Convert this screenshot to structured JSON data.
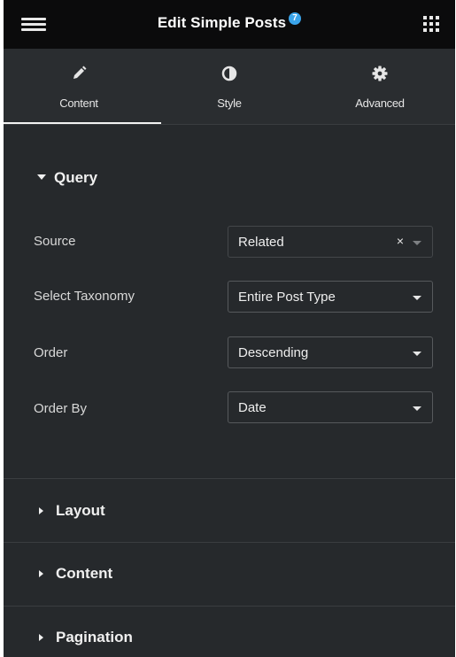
{
  "header": {
    "title": "Edit Simple Posts",
    "badge": "7",
    "menu_icon": "hamburger-icon",
    "apps_icon": "grid-icon"
  },
  "tabs": [
    {
      "label": "Content",
      "icon": "pencil-icon",
      "active": true
    },
    {
      "label": "Style",
      "icon": "half-circle-icon",
      "active": false
    },
    {
      "label": "Advanced",
      "icon": "gear-icon",
      "active": false
    }
  ],
  "query": {
    "title": "Query",
    "rows": [
      {
        "label": "Source",
        "value": "Related",
        "clearable": true,
        "clear_symbol": "×"
      },
      {
        "label": "Select Taxonomy",
        "value": "Entire Post Type"
      },
      {
        "label": "Order",
        "value": "Descending"
      },
      {
        "label": "Order By",
        "value": "Date"
      }
    ]
  },
  "sections": [
    {
      "title": "Layout"
    },
    {
      "title": "Content"
    },
    {
      "title": "Pagination"
    }
  ],
  "colors": {
    "panel_bg": "#26292c",
    "topbar_bg": "#0b0b0c",
    "badge": "#3aa4ea"
  }
}
